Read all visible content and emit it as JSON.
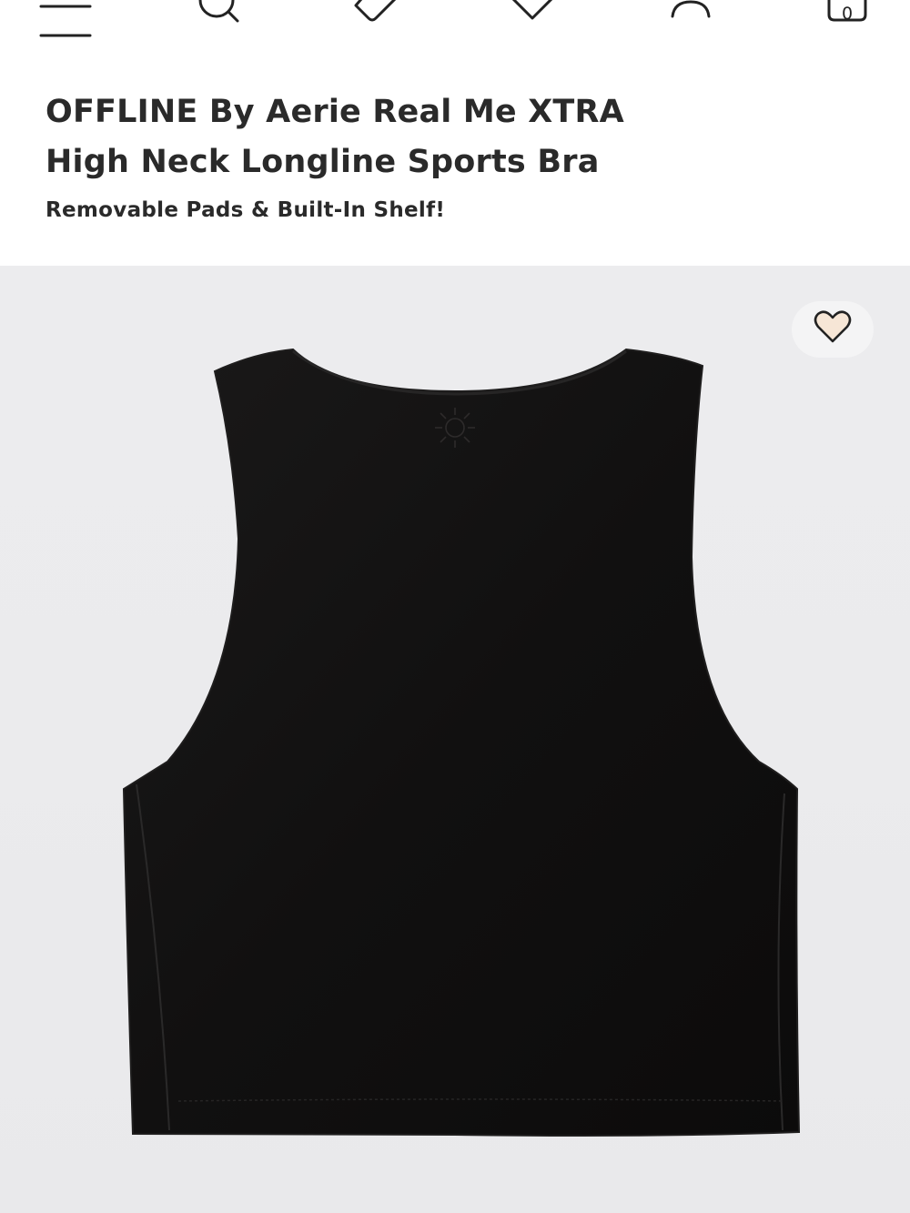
{
  "nav": {
    "cart_count": "0"
  },
  "product": {
    "title_line1": "OFFLINE By Aerie Real Me XTRA",
    "title_line2": "High Neck Longline Sports Bra",
    "subtitle": "Removable Pads & Built-In Shelf!"
  },
  "colors": {
    "image_bg": "#ebebed",
    "garment": "#111111",
    "favorite_fill": "#f6e6d6"
  }
}
